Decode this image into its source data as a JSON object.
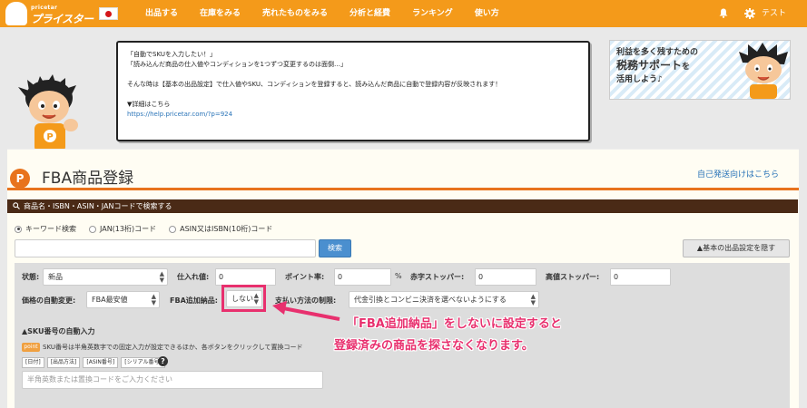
{
  "header": {
    "logo_small": "pricetar",
    "logo_big": "プライスター",
    "nav": [
      "出品する",
      "在庫をみる",
      "売れたものをみる",
      "分析と経費",
      "ランキング",
      "使い方"
    ],
    "user_name": "テスト"
  },
  "bubble": {
    "line1": "「自動でSKUを入力したい！」",
    "line2": "「読み込んだ商品の仕入値やコンディションを1つずつ変更するのは面倒…」",
    "line3": "そんな時は【基本の出品設定】で仕入値やSKU、コンディションを登録すると、読み込んだ商品に自動で登録内容が反映されます！",
    "line4": "▼詳細はこちら",
    "link": "https://help.pricetar.com/?p=924"
  },
  "banner": {
    "line1": "利益を多く残すための",
    "line2_strong": "税務サポート",
    "line2_rest": "を",
    "line3": "活用しよう♪"
  },
  "page": {
    "title": "FBA商品登録",
    "self_shipping_link": "自己発送向けはこちら",
    "search_header": "商品名・ISBN・ASIN・JANコードで検索する"
  },
  "search": {
    "radio_options": [
      "キーワード検索",
      "JAN(13桁)コード",
      "ASIN又はISBN(10桁)コード"
    ],
    "selected_radio": 0,
    "button": "検索",
    "hide_settings_button": "▲基本の出品設定を隠す"
  },
  "settings": {
    "condition_label": "状態:",
    "condition_value": "新品",
    "cost_label": "仕入れ値:",
    "cost_value": "0",
    "point_label": "ポイント率:",
    "point_value": "0",
    "point_unit": "%",
    "red_stopper_label": "赤字ストッパー:",
    "red_stopper_value": "0",
    "high_stopper_label": "高値ストッパー:",
    "high_stopper_value": "0",
    "auto_price_label": "価格の自動変更:",
    "auto_price_value": "FBA最安値",
    "fba_add_label": "FBA追加納品:",
    "fba_add_value": "しない",
    "payment_label": "支払い方法の制限:",
    "payment_value": "代金引換とコンビニ決済を選べないようにする"
  },
  "callout": {
    "line1": "「FBA追加納品」をしないに設定すると",
    "line2": "登録済みの商品を探さなくなります。"
  },
  "sku": {
    "heading": "▲SKU番号の自動入力",
    "point_badge": "point",
    "description": "SKU番号は半角英数字での固定入力が設定できるほか、各ボタンをクリックして置換コード",
    "chips": [
      "[日付]",
      "[出品方法]",
      "[ASIN番号]",
      "[シリアル番号]"
    ],
    "help": "?",
    "placeholder": "半角英数または置換コードをご入力ください"
  }
}
